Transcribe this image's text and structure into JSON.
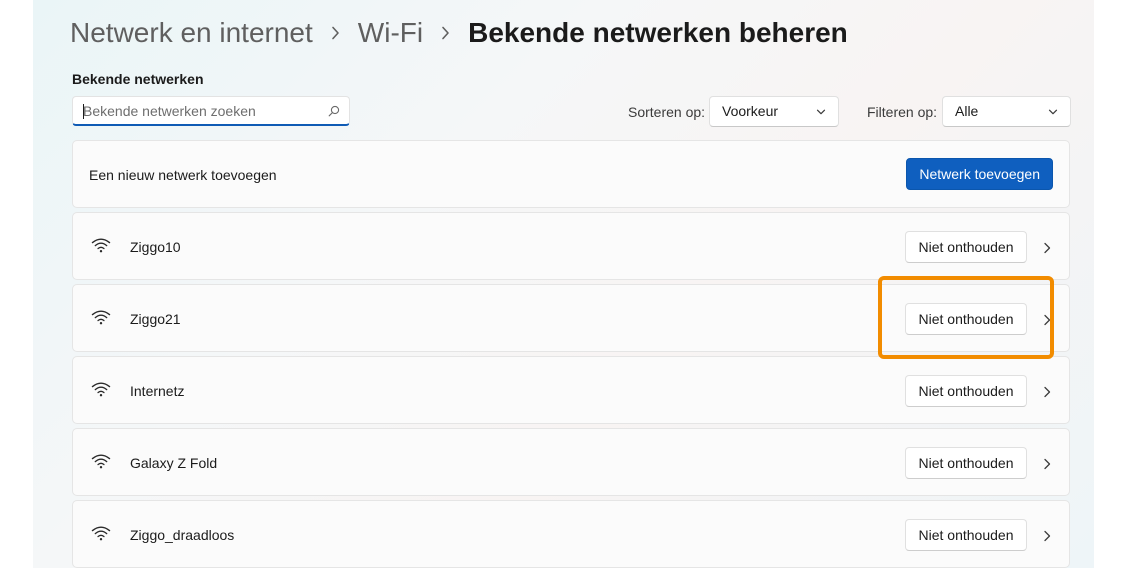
{
  "breadcrumb": {
    "items": [
      "Netwerk en internet",
      "Wi-Fi"
    ],
    "current": "Bekende netwerken beheren"
  },
  "known_networks": {
    "section_label": "Bekende netwerken",
    "search_placeholder": "Bekende netwerken zoeken",
    "sort": {
      "label": "Sorteren op:",
      "value": "Voorkeur"
    },
    "filter": {
      "label": "Filteren op:",
      "value": "Alle"
    }
  },
  "add_network": {
    "text": "Een nieuw netwerk toevoegen",
    "button_label": "Netwerk toevoegen"
  },
  "networks": [
    {
      "name": "Ziggo10",
      "forget_label": "Niet onthouden"
    },
    {
      "name": "Ziggo21",
      "forget_label": "Niet onthouden"
    },
    {
      "name": "Internetz",
      "forget_label": "Niet onthouden"
    },
    {
      "name": "Galaxy Z Fold",
      "forget_label": "Niet onthouden"
    },
    {
      "name": "Ziggo_draadloos",
      "forget_label": "Niet onthouden"
    }
  ],
  "colors": {
    "accent": "#0f5fbf",
    "highlight": "#f28c00"
  }
}
